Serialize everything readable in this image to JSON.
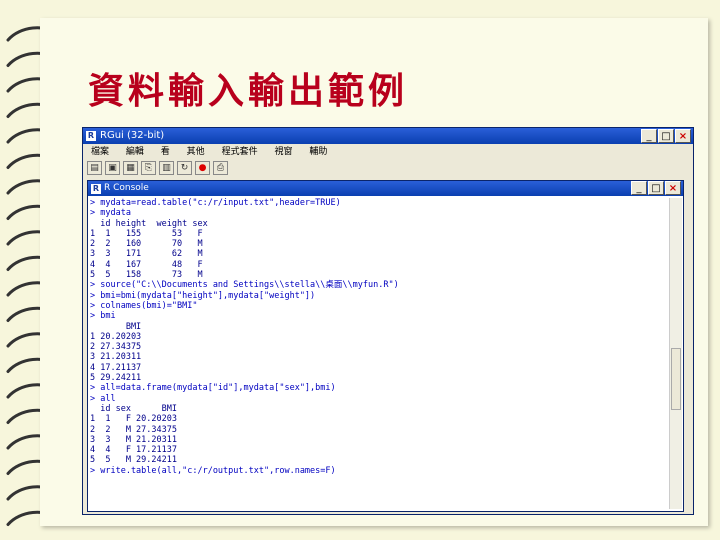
{
  "slide_title": "資料輸入輸出範例",
  "rgui": {
    "title": "RGui (32-bit)",
    "menu": [
      "檔案",
      "編輯",
      "看",
      "其他",
      "程式套件",
      "視窗",
      "輔助"
    ],
    "toolbar": [
      "open-script",
      "load-workspace",
      "save-workspace",
      "copy",
      "paste",
      "copy-paste",
      "stop",
      "print"
    ]
  },
  "console": {
    "title": "R Console",
    "lines": [
      {
        "text": "> mydata=read.table(\"c:/r/input.txt\",header=TRUE)",
        "kind": "cmd"
      },
      {
        "text": "> mydata",
        "kind": "cmd"
      },
      {
        "text": "  id height  weight sex",
        "kind": "out"
      },
      {
        "text": "1  1   155      53   F",
        "kind": "out"
      },
      {
        "text": "2  2   160      70   M",
        "kind": "out"
      },
      {
        "text": "3  3   171      62   M",
        "kind": "out"
      },
      {
        "text": "4  4   167      48   F",
        "kind": "out"
      },
      {
        "text": "5  5   158      73   M",
        "kind": "out"
      },
      {
        "text": "> source(\"C:\\\\Documents and Settings\\\\stella\\\\桌面\\\\myfun.R\")",
        "kind": "cmd"
      },
      {
        "text": "> bmi=bmi(mydata[\"height\"],mydata[\"weight\"])",
        "kind": "cmd"
      },
      {
        "text": "> colnames(bmi)=\"BMI\"",
        "kind": "cmd"
      },
      {
        "text": "> bmi",
        "kind": "cmd"
      },
      {
        "text": "       BMI",
        "kind": "out"
      },
      {
        "text": "1 20.20203",
        "kind": "out"
      },
      {
        "text": "2 27.34375",
        "kind": "out"
      },
      {
        "text": "3 21.20311",
        "kind": "out"
      },
      {
        "text": "4 17.21137",
        "kind": "out"
      },
      {
        "text": "5 29.24211",
        "kind": "out"
      },
      {
        "text": "> all=data.frame(mydata[\"id\"],mydata[\"sex\"],bmi)",
        "kind": "cmd"
      },
      {
        "text": "> all",
        "kind": "cmd"
      },
      {
        "text": "  id sex      BMI",
        "kind": "out"
      },
      {
        "text": "1  1   F 20.20203",
        "kind": "out"
      },
      {
        "text": "2  2   M 27.34375",
        "kind": "out"
      },
      {
        "text": "3  3   M 21.20311",
        "kind": "out"
      },
      {
        "text": "4  4   F 17.21137",
        "kind": "out"
      },
      {
        "text": "5  5   M 29.24211",
        "kind": "out"
      },
      {
        "text": "> write.table(all,\"c:/r/output.txt\",row.names=F)",
        "kind": "cmd"
      }
    ]
  }
}
